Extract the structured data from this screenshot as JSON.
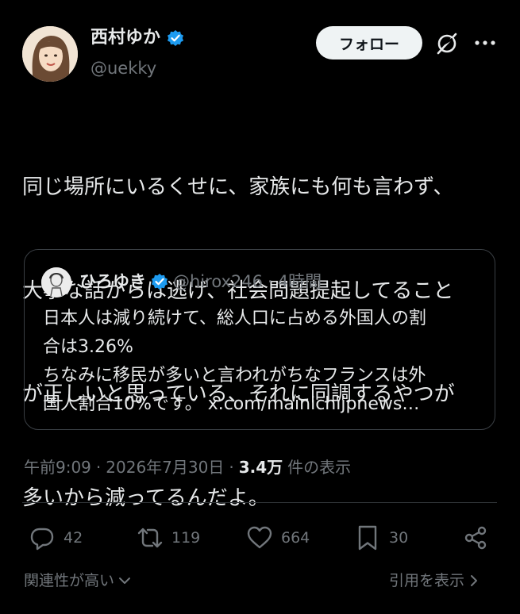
{
  "author": {
    "display_name": "西村ゆか",
    "handle": "@uekky",
    "follow_label": "フォロー"
  },
  "tweet": {
    "text_lines": [
      "同じ場所にいるくせに、家族にも何も言わず、",
      "大事な話からは逃げ、社会問題提起してること",
      "が正しいと思っている、それに同調するやつが",
      "多いから減ってるんだよ。"
    ]
  },
  "quote": {
    "display_name": "ひろゆき",
    "handle": "@hirox246",
    "separator": "·",
    "time": "4時間",
    "text_lines": [
      "日本人は減り続けて、総人口に占める外国人の割",
      "合は3.26%",
      "ちなみに移民が多いと言われがちなフランスは外",
      "国人割合10%です。"
    ],
    "link": "x.com/mainichijpnews…"
  },
  "meta": {
    "time": "午前9:09",
    "sep1": "·",
    "date": "2026年7月30日",
    "sep2": "·",
    "views": "3.4万",
    "views_label": "件の表示"
  },
  "actions": {
    "replies": "42",
    "reposts": "119",
    "likes": "664",
    "bookmarks": "30"
  },
  "footer": {
    "relevance": "関連性が高い",
    "view_quotes": "引用を表示"
  },
  "colors": {
    "background": "#000000",
    "text": "#e7e9ea",
    "muted": "#71767b",
    "verified": "#1d9bf0",
    "border": "#2f3336"
  }
}
